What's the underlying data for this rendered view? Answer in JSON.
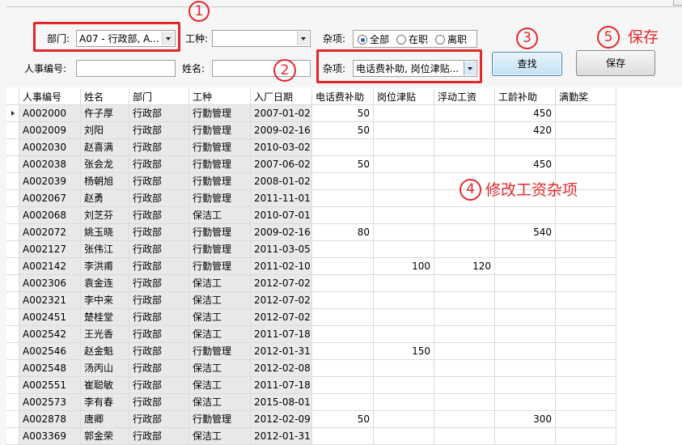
{
  "filters": {
    "dept_label": "部门:",
    "dept_value": "A07 - 行政部, A...",
    "worktype_label": "工种:",
    "worktype_value": "",
    "misc_label": "杂项:",
    "status_options": [
      "全部",
      "在职",
      "离职"
    ],
    "status_selected": "全部",
    "emp_id_label": "人事编号:",
    "emp_id_value": "",
    "name_label": "姓名:",
    "name_value": "",
    "misc_items_label": "杂项:",
    "misc_items_value": "电话费补助, 岗位津贴..."
  },
  "buttons": {
    "search": "查找",
    "save": "保存"
  },
  "annotations": {
    "c1": "1",
    "c2": "2",
    "c3": "3",
    "c4": "4",
    "c5": "5",
    "text4": "修改工资杂项",
    "text5": "保存"
  },
  "annotation_color": "#e3282c",
  "grid": {
    "columns": [
      "人事编号",
      "姓名",
      "部门",
      "工种",
      "入厂日期",
      "电话费补助",
      "岗位津贴",
      "浮动工资",
      "工龄补助",
      "满勤奖"
    ],
    "rows": [
      [
        "A002000",
        "仵子厚",
        "行政部",
        "行勤管理",
        "2007-01-02",
        "50",
        "",
        "",
        "450",
        ""
      ],
      [
        "A002009",
        "刘阳",
        "行政部",
        "行勤管理",
        "2009-02-16",
        "50",
        "",
        "",
        "420",
        ""
      ],
      [
        "A002030",
        "赵喜满",
        "行政部",
        "行勤管理",
        "2010-03-02",
        "",
        "",
        "",
        "",
        ""
      ],
      [
        "A002038",
        "张会龙",
        "行政部",
        "行勤管理",
        "2007-06-02",
        "50",
        "",
        "",
        "450",
        ""
      ],
      [
        "A002039",
        "杨朝旭",
        "行政部",
        "行勤管理",
        "2008-01-02",
        "",
        "",
        "",
        "",
        ""
      ],
      [
        "A002067",
        "赵勇",
        "行政部",
        "行勤管理",
        "2011-11-01",
        "",
        "",
        "",
        "",
        ""
      ],
      [
        "A002068",
        "刘芝芬",
        "行政部",
        "保洁工",
        "2010-07-01",
        "",
        "",
        "",
        "",
        ""
      ],
      [
        "A002072",
        "姚玉晓",
        "行政部",
        "行勤管理",
        "2009-02-16",
        "80",
        "",
        "",
        "540",
        ""
      ],
      [
        "A002127",
        "张伟江",
        "行政部",
        "行勤管理",
        "2011-03-05",
        "",
        "",
        "",
        "",
        ""
      ],
      [
        "A002142",
        "李洪甫",
        "行政部",
        "行勤管理",
        "2011-02-10",
        "",
        "100",
        "120",
        "",
        ""
      ],
      [
        "A002306",
        "袁金连",
        "行政部",
        "保洁工",
        "2012-07-02",
        "",
        "",
        "",
        "",
        ""
      ],
      [
        "A002321",
        "李中来",
        "行政部",
        "保洁工",
        "2012-07-02",
        "",
        "",
        "",
        "",
        ""
      ],
      [
        "A002451",
        "楚桂堂",
        "行政部",
        "保洁工",
        "2012-07-02",
        "",
        "",
        "",
        "",
        ""
      ],
      [
        "A002542",
        "王光香",
        "行政部",
        "保洁工",
        "2011-07-18",
        "",
        "",
        "",
        "",
        ""
      ],
      [
        "A002546",
        "赵金魁",
        "行政部",
        "行勤管理",
        "2012-01-31",
        "",
        "150",
        "",
        "",
        ""
      ],
      [
        "A002548",
        "汤丙山",
        "行政部",
        "保洁工",
        "2012-02-08",
        "",
        "",
        "",
        "",
        ""
      ],
      [
        "A002551",
        "崔聪敏",
        "行政部",
        "保洁工",
        "2011-07-18",
        "",
        "",
        "",
        "",
        ""
      ],
      [
        "A002573",
        "李有春",
        "行政部",
        "保洁工",
        "2015-08-01",
        "",
        "",
        "",
        "",
        ""
      ],
      [
        "A002878",
        "唐卿",
        "行政部",
        "行勤管理",
        "2012-02-09",
        "50",
        "",
        "",
        "300",
        ""
      ],
      [
        "A003369",
        "郭金荣",
        "行政部",
        "保洁工",
        "2012-01-31",
        "",
        "",
        "",
        "",
        ""
      ]
    ],
    "current_row": 0
  }
}
